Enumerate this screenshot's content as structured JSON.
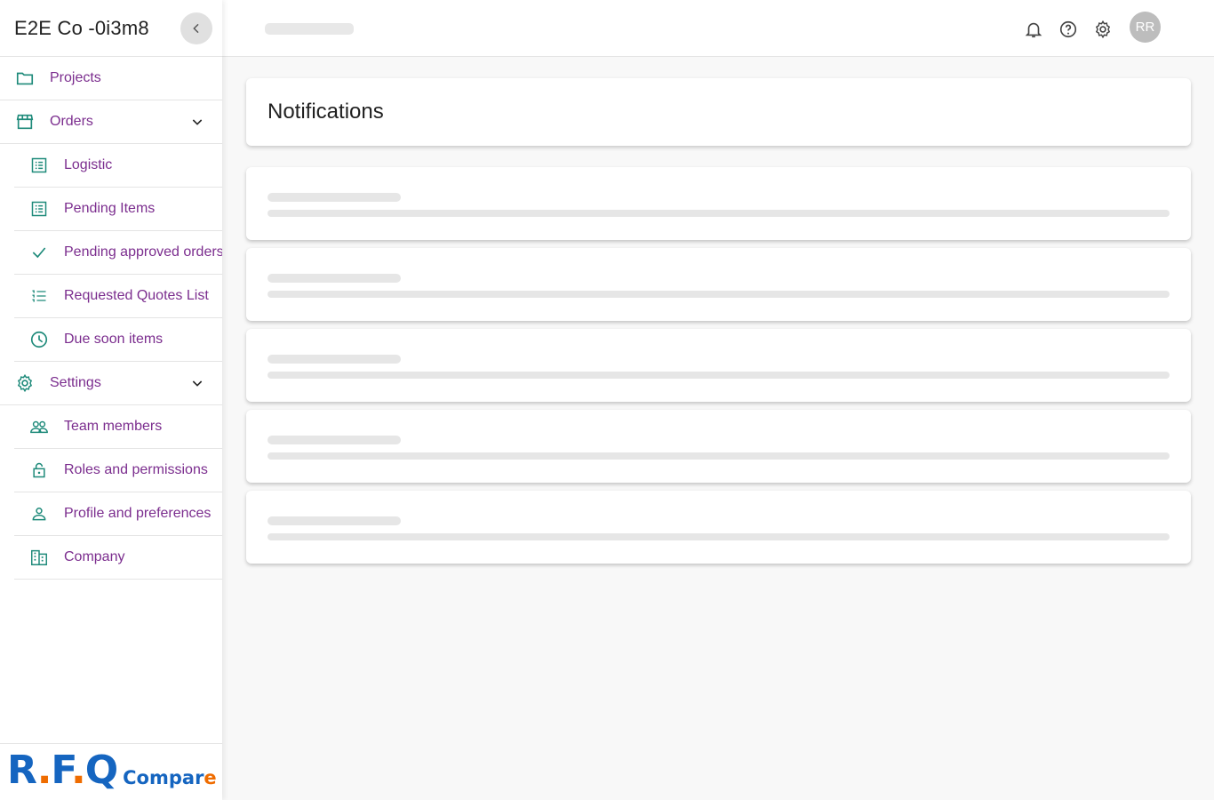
{
  "sidebar": {
    "company_name": "E2E Co -0i3m8",
    "items": [
      {
        "label": "Projects",
        "icon": "folder-icon"
      },
      {
        "label": "Orders",
        "icon": "storefront-icon"
      },
      {
        "label": "Logistic",
        "icon": "list-alt-icon"
      },
      {
        "label": "Pending Items",
        "icon": "list-alt-icon"
      },
      {
        "label": "Pending approved orders",
        "icon": "check-icon"
      },
      {
        "label": "Requested Quotes List",
        "icon": "format-list-numbered-icon"
      },
      {
        "label": "Due soon items",
        "icon": "clock-icon"
      },
      {
        "label": "Settings",
        "icon": "gear-icon"
      },
      {
        "label": "Team members",
        "icon": "people-icon"
      },
      {
        "label": "Roles and permissions",
        "icon": "lock-icon"
      },
      {
        "label": "Profile and preferences",
        "icon": "person-icon"
      },
      {
        "label": "Company",
        "icon": "building-icon"
      }
    ],
    "logo": {
      "part1": "R",
      "dot1": ".",
      "part2": "F",
      "dot2": ".",
      "part3": "Q",
      "compare_a": "Compar",
      "compare_b": "e"
    }
  },
  "topbar": {
    "avatar_initials": "RR",
    "icons": [
      "bell-icon",
      "help-icon",
      "gear-icon"
    ]
  },
  "main": {
    "title": "Notifications"
  },
  "colors": {
    "accent_text": "#7b2d8e",
    "icon_teal": "#1e8a7a",
    "logo_blue": "#1565c0",
    "logo_orange": "#ef6c00"
  }
}
